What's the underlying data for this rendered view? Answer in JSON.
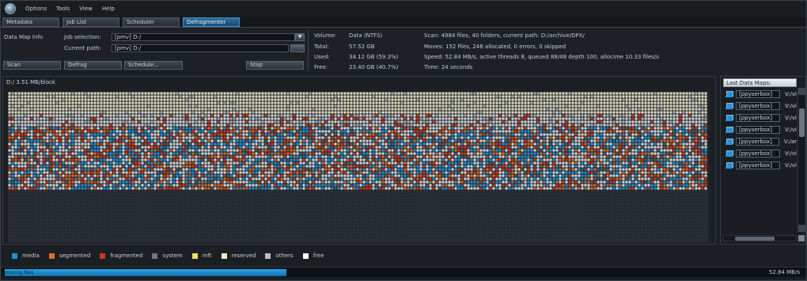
{
  "menu": [
    "Options",
    "Tools",
    "View",
    "Help"
  ],
  "tabs": [
    {
      "label": "Metadata",
      "active": false
    },
    {
      "label": "Job List",
      "active": false
    },
    {
      "label": "Scheduler",
      "active": false
    },
    {
      "label": "Defragmenter",
      "active": true
    }
  ],
  "info": {
    "section_title": "Data Map Info",
    "job_selection_label": "Job selection:",
    "job_selection_value": "[pmv] D:/",
    "current_path_label": "Current path:",
    "current_path_value": "[pmv] D:/",
    "buttons": {
      "scan": "Scan",
      "defrag": "Defrag",
      "schedule": "Schedule...",
      "stop": "Stop"
    },
    "volume_label": "Volume:",
    "volume_value": "Data (NTFS)",
    "total_label": "Total:",
    "total_value": "57.52 GB",
    "used_label": "Used:",
    "used_value": "34.12 GB (59.3%)",
    "free_label": "Free:",
    "free_value": "23.40 GB (40.7%)",
    "scan_line": "Scan: 4984 files, 40 folders, current path: D:/archive/DPX/",
    "moves_line": "Moves: 152 files, 248 allocated, 0 errors, 0 skipped",
    "speed_line": "Speed: 52.84 MB/s, active threads 8, queued 88/48 depth 100, allocime 10.33 files/s",
    "time_line": "Time: 24 seconds"
  },
  "map": {
    "title": "D:/ 3.51 MB/block"
  },
  "last_maps": {
    "title": "Last Data Maps:",
    "items": [
      {
        "name": "[ppyserbox]",
        "path": "V:/vi"
      },
      {
        "name": "[ppyserbox]",
        "path": "V:/vi"
      },
      {
        "name": "[ppyserbox]",
        "path": "V:/vi"
      },
      {
        "name": "[ppyserbox]",
        "path": "V:/vi"
      },
      {
        "name": "[ppyserbox]",
        "path": "V:/ar"
      },
      {
        "name": "[ppyserbox]",
        "path": "V:/vi"
      },
      {
        "name": "[ppyserbox]",
        "path": "V:/vi"
      }
    ]
  },
  "legend": [
    {
      "label": "media",
      "color": "#1f8fd0"
    },
    {
      "label": "segmented",
      "color": "#e06a2a"
    },
    {
      "label": "fragmented",
      "color": "#c23a22"
    },
    {
      "label": "system",
      "color": "#6f767c"
    },
    {
      "label": "mft",
      "color": "#e8e06a"
    },
    {
      "label": "reserved",
      "color": "#efe8c6"
    },
    {
      "label": "others",
      "color": "#b9bec3"
    },
    {
      "label": "free",
      "color": "#ffffff"
    }
  ],
  "status": {
    "progress_text": "moving files",
    "progress_fraction": 0.35,
    "speed": "52.84 MB/s"
  }
}
